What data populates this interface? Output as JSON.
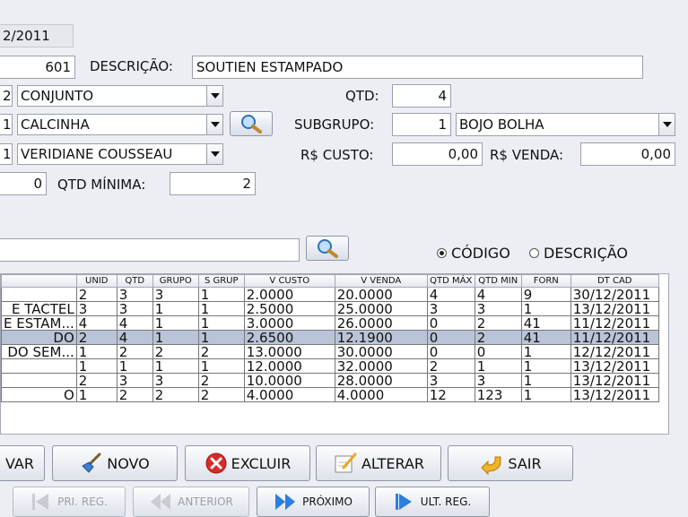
{
  "form": {
    "date_value": "2/2011",
    "codigo_value": "601",
    "descricao_label": "DESCRIÇÃO:",
    "descricao_value": "SOUTIEN ESTAMPADO",
    "conjunto_code": "2",
    "conjunto_value": "CONJUNTO",
    "qtd_label": "QTD:",
    "qtd_value": "4",
    "grupo_code": "1",
    "grupo_value": "CALCINHA",
    "subgrupo_label": "SUBGRUPO:",
    "subgrupo_code": "1",
    "subgrupo_value": "BOJO BOLHA",
    "forn_code": "1",
    "forn_value": "VERIDIANE COUSSEAU",
    "custo_label": "R$ CUSTO:",
    "custo_value": "0,00",
    "venda_label": "R$ VENDA:",
    "venda_value": "0,00",
    "unid_value": "0",
    "qtd_minima_label": "QTD MÍNIMA:",
    "qtd_minima_value": "2"
  },
  "search": {
    "value": "",
    "radio_codigo": "CÓDIGO",
    "radio_descricao": "DESCRIÇÃO",
    "selected": "codigo"
  },
  "table": {
    "headers": [
      "",
      "UNID",
      "QTD",
      "GRUPO",
      "S GRUP",
      "V CUSTO",
      "V VENDA",
      "QTD MÁX",
      "QTD MIN",
      "FORN",
      "DT CAD"
    ],
    "rows": [
      [
        "",
        "2",
        "3",
        "3",
        "1",
        "2.0000",
        "20.0000",
        "4",
        "4",
        "9",
        "30/12/2011"
      ],
      [
        "E TACTEL",
        "3",
        "3",
        "1",
        "1",
        "2.5000",
        "25.0000",
        "3",
        "3",
        "1",
        "13/12/2011"
      ],
      [
        "E ESTAM...",
        "4",
        "4",
        "1",
        "1",
        "3.0000",
        "26.0000",
        "0",
        "2",
        "41",
        "11/12/2011"
      ],
      [
        "DO",
        "2",
        "4",
        "1",
        "1",
        "2.6500",
        "12.1900",
        "0",
        "2",
        "41",
        "11/12/2011"
      ],
      [
        "DO SEM...",
        "1",
        "2",
        "2",
        "2",
        "13.0000",
        "30.0000",
        "0",
        "0",
        "1",
        "12/12/2011"
      ],
      [
        "",
        "1",
        "1",
        "1",
        "1",
        "12.0000",
        "32.0000",
        "2",
        "1",
        "1",
        "13/12/2011"
      ],
      [
        "",
        "2",
        "3",
        "3",
        "2",
        "10.0000",
        "28.0000",
        "3",
        "3",
        "1",
        "13/12/2011"
      ],
      [
        "O",
        "1",
        "2",
        "2",
        "2",
        "4.0000",
        "4.0000",
        "12",
        "123",
        "1",
        "13/12/2011"
      ]
    ],
    "selected_row": 3
  },
  "buttons": {
    "salvar": "VAR",
    "novo": "NOVO",
    "excluir": "EXCLUIR",
    "alterar": "ALTERAR",
    "sair": "SAIR"
  },
  "navigation": {
    "first": "PRI. REG.",
    "previous": "ANTERIOR",
    "next": "PRÓXIMO",
    "last": "ULT. REG."
  },
  "colors": {
    "background": "#eceef4",
    "selected_row": "#b9c4d8",
    "excluir_icon": "#d92b2b",
    "nav_icon": "#2a7fe0"
  }
}
